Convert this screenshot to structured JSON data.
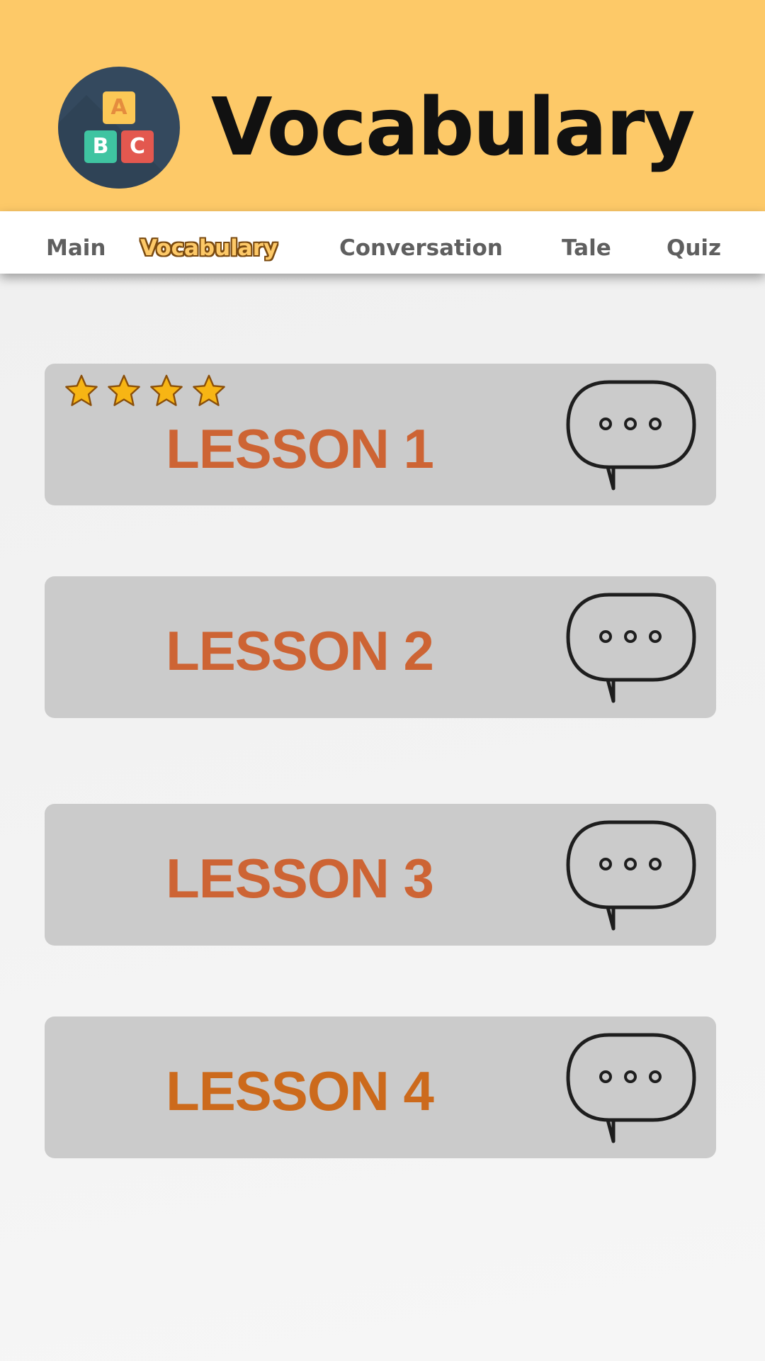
{
  "header": {
    "title": "Vocabulary",
    "logo": {
      "icon": "abc-blocks-icon",
      "letters": [
        "A",
        "B",
        "C"
      ]
    }
  },
  "tabs": [
    {
      "label": "Main",
      "active": false
    },
    {
      "label": "Vocabulary",
      "active": true
    },
    {
      "label": "Conversation",
      "active": false
    },
    {
      "label": "Tale",
      "active": false
    },
    {
      "label": "Quiz",
      "active": false
    }
  ],
  "lessons": [
    {
      "title": "LESSON 1",
      "stars": 4,
      "icon": "speech-bubble-icon"
    },
    {
      "title": "LESSON 2",
      "stars": 0,
      "icon": "speech-bubble-icon"
    },
    {
      "title": "LESSON 3",
      "stars": 0,
      "icon": "speech-bubble-icon"
    },
    {
      "title": "LESSON 4",
      "stars": 0,
      "icon": "speech-bubble-icon"
    }
  ],
  "colors": {
    "header_bg": "#fdc968",
    "lesson_bg": "#cbcbcb",
    "lesson_title": "#cd6434",
    "lesson_4_title": "#cc6a1c",
    "tab_text": "#5f5f5f",
    "star": "#f7b514"
  }
}
